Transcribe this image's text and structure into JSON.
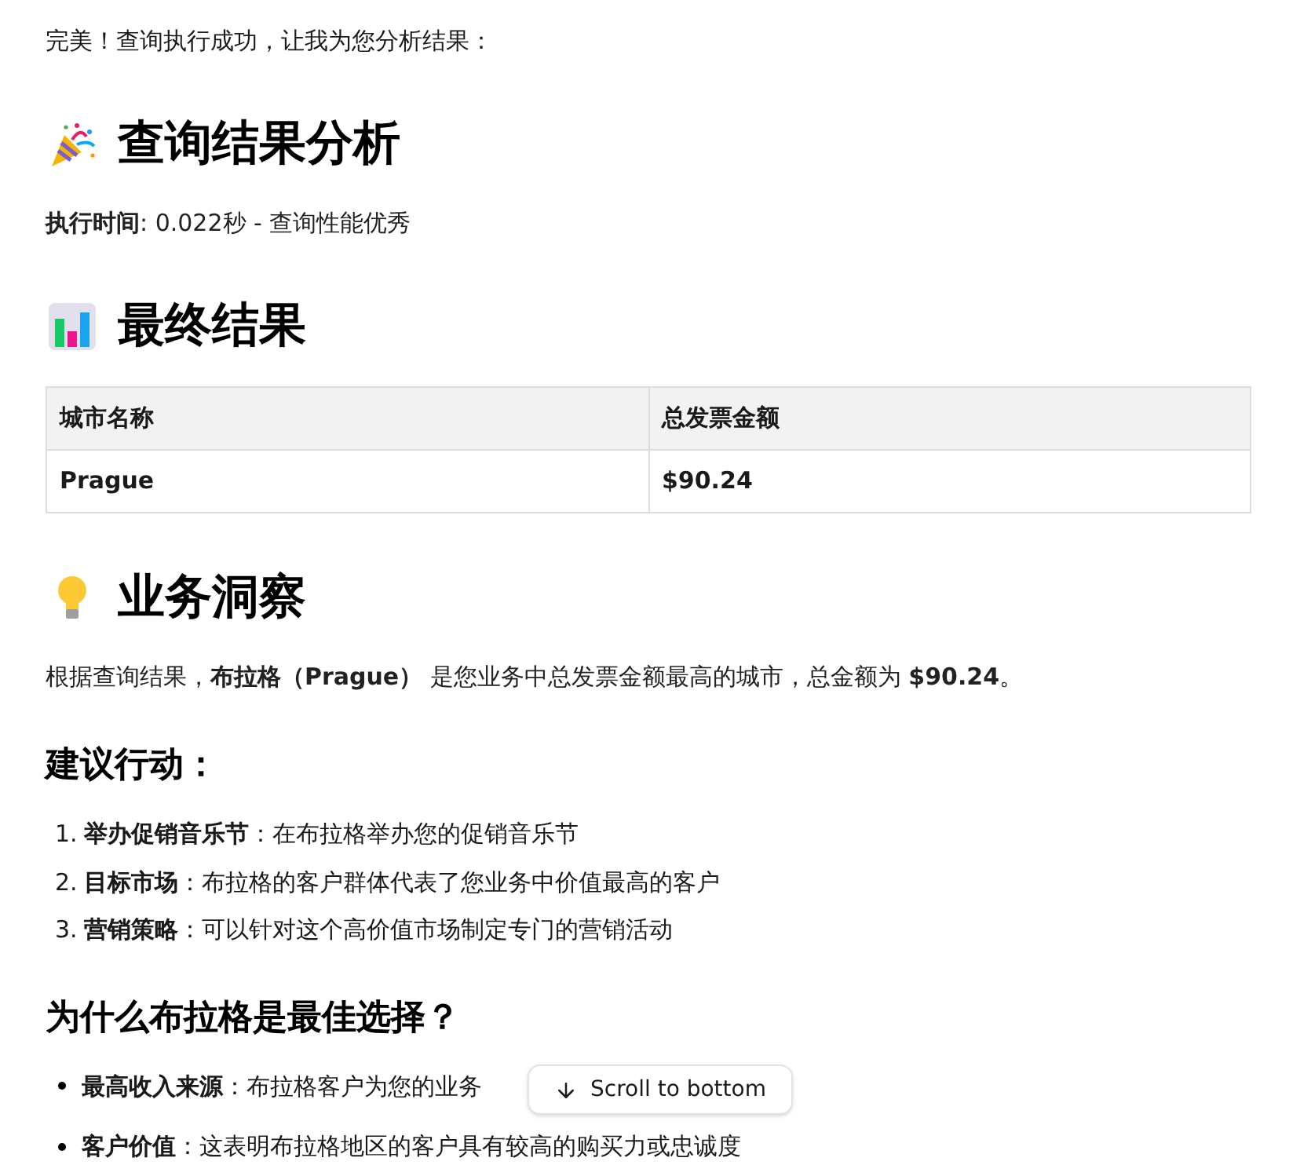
{
  "intro": "完美！查询执行成功，让我为您分析结果：",
  "sections": [
    {
      "kind": "heading",
      "text": "查询结果分析"
    },
    {
      "kind": "paragraph",
      "text": "**执行时间**: 0.022秒 - 查询性能优秀"
    },
    {
      "kind": "heading",
      "text": "最终结果"
    },
    {
      "kind": "table",
      "columns": [
        "城市名称",
        "总发票金额"
      ],
      "rows": [
        [
          "Prague",
          "$90.24"
        ]
      ]
    },
    {
      "kind": "heading",
      "text": "业务洞察"
    },
    {
      "kind": "paragraph",
      "text": "根据查询结果，**布拉格（Prague）** 是您业务中总发票金额最高的城市，总金额为 **$90.24**。"
    },
    {
      "kind": "subheading",
      "text": "建议行动："
    },
    {
      "kind": "ordered",
      "items": [
        {
          "number": "1.",
          "label": "举办促销音乐节",
          "text": "：在布拉格举办您的促销音乐节"
        },
        {
          "number": "2.",
          "label": "目标市场",
          "text": "：布拉格的客户群体代表了您业务中价值最高的客户"
        },
        {
          "number": "3.",
          "label": "营销策略",
          "text": "：可以针对这个高价值市场制定专门的营销活动"
        }
      ]
    },
    {
      "kind": "subheading",
      "text": "为什么布拉格是最佳选择？"
    },
    {
      "kind": "bullets",
      "items": [
        {
          "label": "最高收入来源",
          "text": "：布拉格客户为您的业务"
        },
        {
          "label": "客户价值",
          "text": "：这表明布拉格地区的客户具有较高的购买力或忠诚度"
        }
      ]
    }
  ],
  "scroll_button": "Scroll to bottom"
}
